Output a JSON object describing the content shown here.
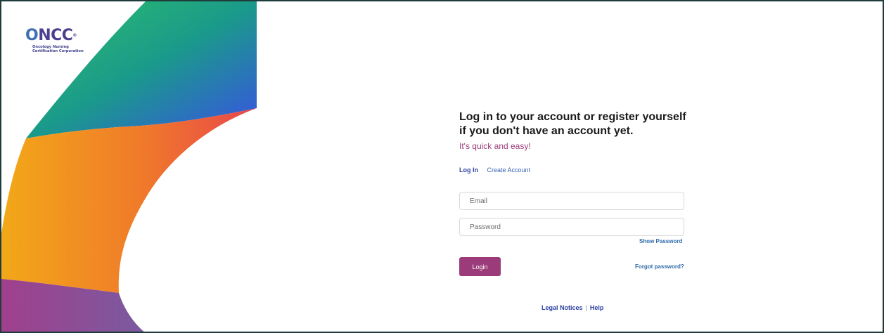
{
  "logo": {
    "word_o": "O",
    "word_rest": "NCC",
    "reg": "®",
    "sub_line1": "Oncology Nursing",
    "sub_line2": "Certification Corporation"
  },
  "main": {
    "heading_line1": "Log in to your account or register yourself",
    "heading_line2": "if you don't have an account yet.",
    "tagline": "It's quick and easy!"
  },
  "tabs": {
    "login": "Log In",
    "create": "Create Account"
  },
  "form": {
    "email_placeholder": "Email",
    "password_placeholder": "Password",
    "show_password": "Show Password",
    "login_button": "Login",
    "forgot_password": "Forgot password?"
  },
  "footer": {
    "legal": "Legal Notices",
    "separator": "|",
    "help": "Help"
  },
  "colors": {
    "accent": "#9b3b79",
    "link": "#2e6aa8",
    "nav": "#2a3fa0",
    "border": "#1f3b3a"
  }
}
